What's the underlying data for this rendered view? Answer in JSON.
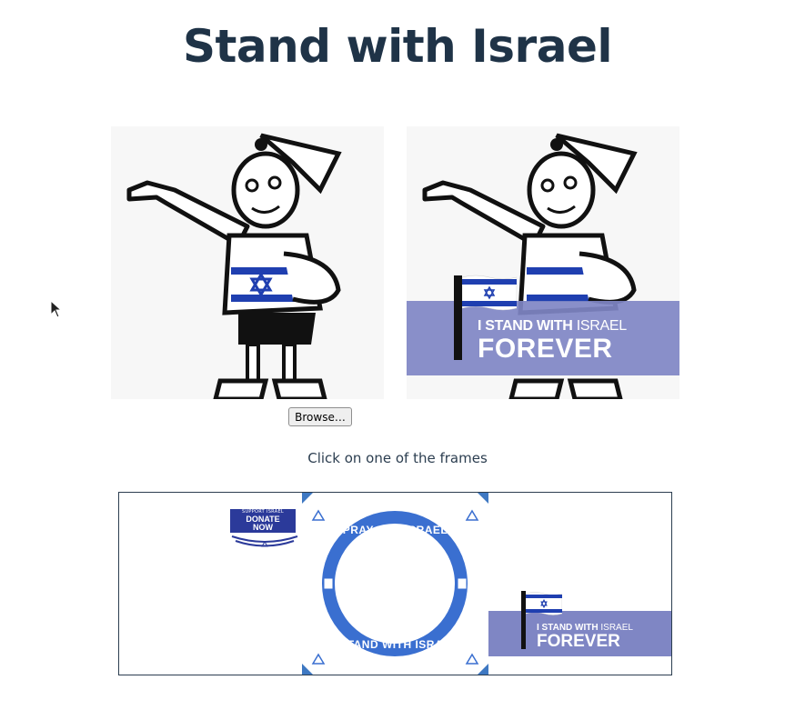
{
  "page": {
    "title": "Stand with Israel",
    "instruction": "Click on one of the frames"
  },
  "upload": {
    "browse_label": "Browse…"
  },
  "preview": {
    "original_alt": "cartoon boy photo",
    "framed_banner_top_bold": "I STAND WITH",
    "framed_banner_top_light": " ISRAEL",
    "framed_banner_bottom": "FOREVER"
  },
  "frames": [
    {
      "id": "donate",
      "badge_small": "SUPPORT ISRAEL",
      "badge_line1": "DONATE",
      "badge_line2": "NOW"
    },
    {
      "id": "pray",
      "top_text": "PRAY FOR ISRAEL",
      "bottom_text": "I STAND WITH ISRAEL"
    },
    {
      "id": "forever",
      "top_bold": "I STAND WITH",
      "top_light": " ISRAEL",
      "bottom": "FOREVER"
    }
  ],
  "colors": {
    "title": "#1f3347",
    "banner": "#7f86c4",
    "israel_blue": "#1f3fb0",
    "pray_frame_blue": "#3e78c2"
  }
}
